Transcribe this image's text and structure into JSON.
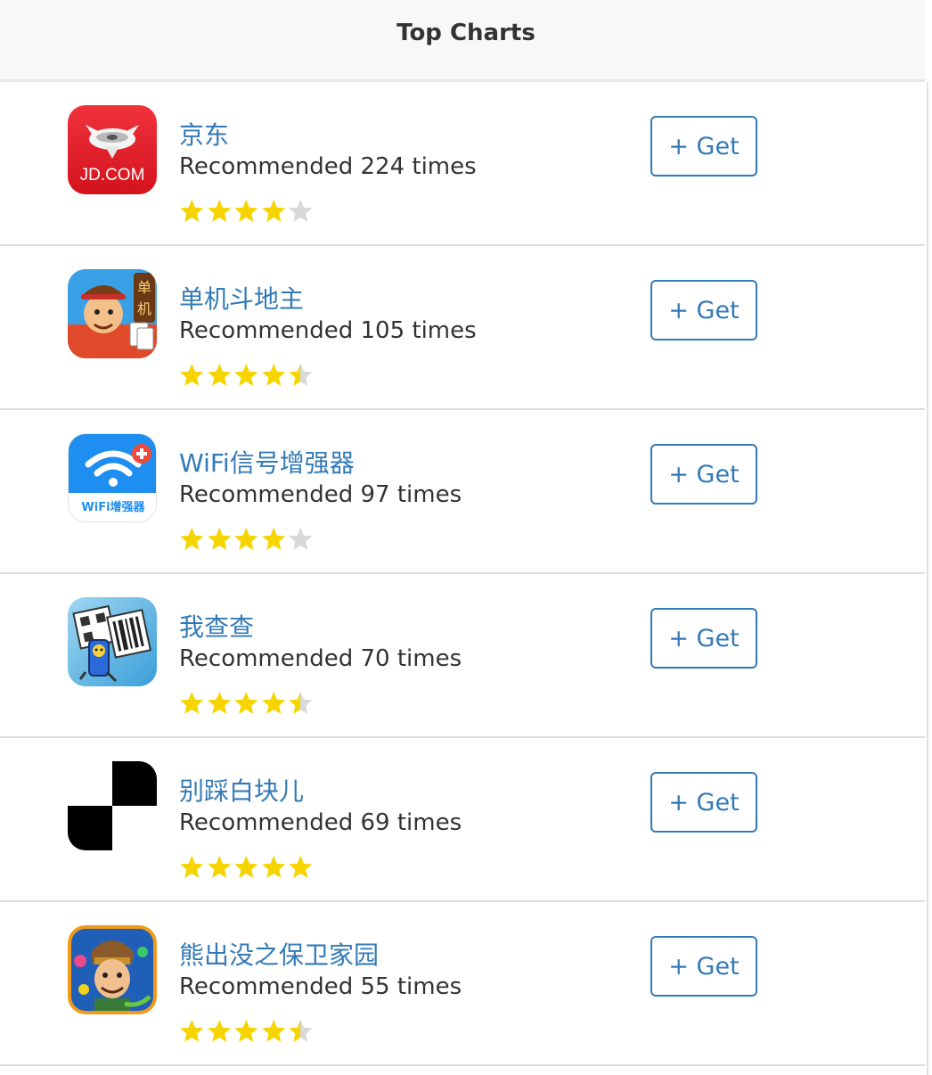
{
  "header": {
    "title": "Top Charts"
  },
  "colors": {
    "link": "#337ab7",
    "star": "#f5d400",
    "star_empty": "#d8d8d8",
    "divider": "#dddddd"
  },
  "apps": [
    {
      "name": "京东",
      "subtitle": "Recommended 224 times",
      "rating": 4,
      "button": "+ Get",
      "icon": "jd-icon",
      "icon_text": "JD.COM"
    },
    {
      "name": "单机斗地主",
      "subtitle": "Recommended 105 times",
      "rating": 4.5,
      "button": "+ Get",
      "icon": "doudizhu-icon",
      "icon_text": "单机"
    },
    {
      "name": "WiFi信号增强器",
      "subtitle": "Recommended 97 times",
      "rating": 4,
      "button": "+ Get",
      "icon": "wifi-icon",
      "icon_text": "WiFi增强器"
    },
    {
      "name": "我查查",
      "subtitle": "Recommended 70 times",
      "rating": 4.5,
      "button": "+ Get",
      "icon": "barcode-icon"
    },
    {
      "name": "别踩白块儿",
      "subtitle": "Recommended 69 times",
      "rating": 5,
      "button": "+ Get",
      "icon": "piano-tiles-icon"
    },
    {
      "name": "熊出没之保卫家园",
      "subtitle": "Recommended 55 times",
      "rating": 4.5,
      "button": "+ Get",
      "icon": "bear-game-icon"
    }
  ]
}
